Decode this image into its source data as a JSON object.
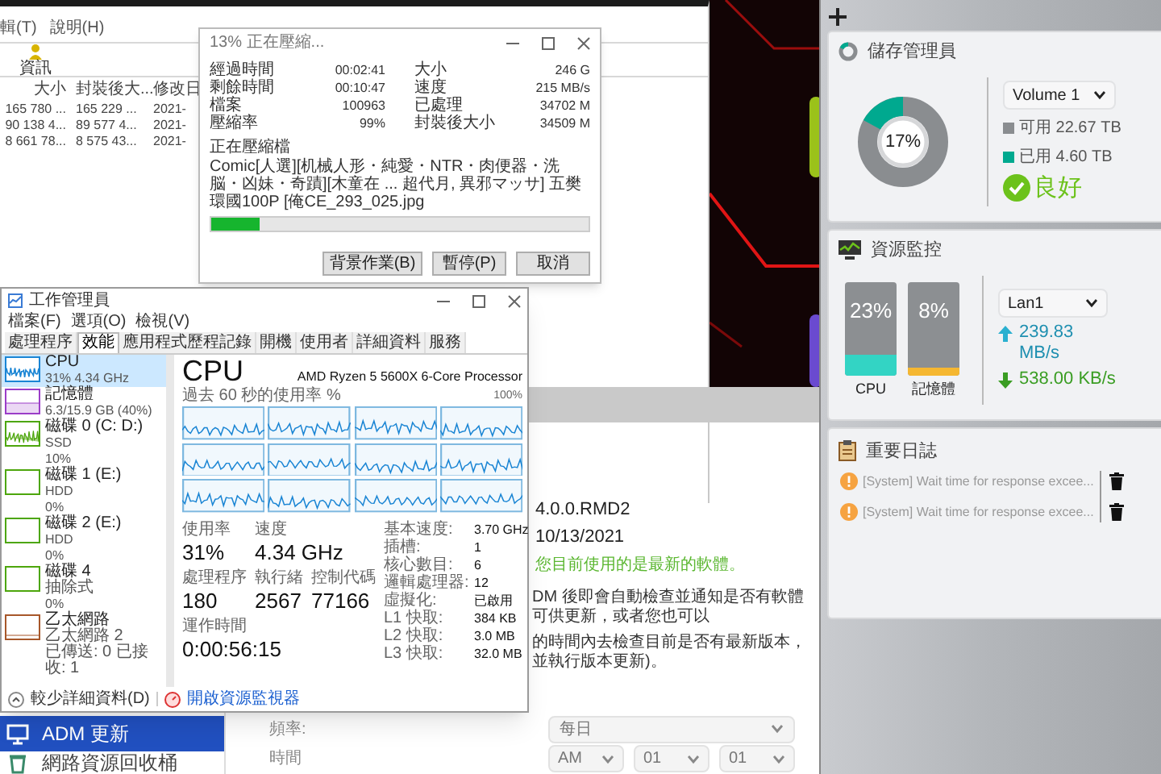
{
  "explorer": {
    "menu": [
      "輯(T)",
      "說明(H)"
    ],
    "toolbar_button": "資訊",
    "columns": [
      "大小",
      "封裝後大...",
      "修改日"
    ],
    "rows": [
      [
        "165 780 ...",
        "165 229 ...",
        "2021-"
      ],
      [
        "90 138 4...",
        "89 577 4...",
        "2021-"
      ],
      [
        "8 661 78...",
        "8 575 43...",
        "2021-"
      ]
    ]
  },
  "compress_dialog": {
    "title": "13% 正在壓縮...",
    "stats_left": [
      {
        "label": "經過時間",
        "value": "00:02:41"
      },
      {
        "label": "剩餘時間",
        "value": "00:10:47"
      },
      {
        "label": "檔案",
        "value": "100963"
      },
      {
        "label": "壓縮率",
        "value": "99%"
      }
    ],
    "stats_right": [
      {
        "label": "大小",
        "value": "246 G"
      },
      {
        "label": "速度",
        "value": "215 MB/s"
      },
      {
        "label": "已處理",
        "value": "34702 M"
      },
      {
        "label": "封裝後大小",
        "value": "34509 M"
      }
    ],
    "current_label": "正在壓縮檔",
    "current_file": "Comic[人選][机械人形・純愛・NTR・肉便器・洗脳・凶妹・奇蹟][木童在 ... 超代月, 異邪マッサ] 五樊環國100P [俺CE_293_025.jpg",
    "level": 0.13,
    "buttons": [
      "背景作業(B)",
      "暫停(P)",
      "取消"
    ]
  },
  "task_manager": {
    "title": "工作管理員",
    "menu": [
      "檔案(F)",
      "選項(O)",
      "檢視(V)"
    ],
    "tabs": [
      {
        "label": "處理程序",
        "selected": false
      },
      {
        "label": "效能",
        "selected": true
      },
      {
        "label": "應用程式歷程記錄",
        "selected": false
      },
      {
        "label": "開機",
        "selected": false
      },
      {
        "label": "使用者",
        "selected": false
      },
      {
        "label": "詳細資料",
        "selected": false
      },
      {
        "label": "服務",
        "selected": false
      }
    ],
    "devices": [
      {
        "kind": "cpu",
        "name": "CPU",
        "lines": [
          "31% 4.34 GHz"
        ],
        "selected": true,
        "active": true,
        "color": "#1a85d4"
      },
      {
        "kind": "memory",
        "name": "記憶體",
        "lines": [
          "6.3/15.9 GB (40%)"
        ],
        "selected": false,
        "active": true,
        "color": "#9b3dc8"
      },
      {
        "kind": "disk",
        "name": "磁碟 0 (C: D:)",
        "lines": [
          "SSD",
          "10%"
        ],
        "selected": false,
        "active": true,
        "color": "#4da60c"
      },
      {
        "kind": "disk",
        "name": "磁碟 1 (E:)",
        "lines": [
          "HDD",
          "0%"
        ],
        "selected": false,
        "active": false,
        "color": "#4da60c"
      },
      {
        "kind": "disk",
        "name": "磁碟 2 (E:)",
        "lines": [
          "HDD",
          "0%"
        ],
        "selected": false,
        "active": false,
        "color": "#4da60c"
      },
      {
        "kind": "disk",
        "name": "磁碟 4",
        "lines": [
          "抽除式",
          "0%"
        ],
        "selected": false,
        "active": false,
        "color": "#4da60c"
      },
      {
        "kind": "network",
        "name": "乙太網路",
        "lines": [
          "乙太網路 2",
          "已傳送: 0 已接收: 1"
        ],
        "selected": false,
        "active": true,
        "color": "#a7572a"
      }
    ],
    "heading": "CPU",
    "processor": "AMD Ryzen 5 5600X 6-Core Processor",
    "graph_caption": "過去 60 秒的使用率 %",
    "graph_max": "100%",
    "stats": [
      {
        "label": "使用率",
        "value": "31%"
      },
      {
        "label": "速度",
        "value": "4.34 GHz"
      },
      {
        "label": "處理程序",
        "value": "180"
      },
      {
        "label": "執行緒",
        "value": "2567"
      },
      {
        "label": "控制代碼",
        "value": "77166"
      },
      {
        "label": "運作時間",
        "value": "0:00:56:15"
      }
    ],
    "specs": [
      {
        "label": "基本速度:",
        "value": "3.70 GHz"
      },
      {
        "label": "插槽:",
        "value": "1"
      },
      {
        "label": "核心數目:",
        "value": "6"
      },
      {
        "label": "邏輯處理器:",
        "value": "12"
      },
      {
        "label": "虛擬化:",
        "value": "已啟用"
      },
      {
        "label": "L1 快取:",
        "value": "384 KB"
      },
      {
        "label": "L2 快取:",
        "value": "3.0 MB"
      },
      {
        "label": "L3 快取:",
        "value": "32.0 MB"
      }
    ],
    "footer": {
      "less_details": "較少詳細資料(D)",
      "resource_monitor": "開啟資源監視器"
    }
  },
  "adm": {
    "sidebar": [
      {
        "label": "ADM 更新",
        "selected": true
      },
      {
        "label": "網路資源回收桶",
        "selected": false
      }
    ],
    "version": "4.0.0.RMD2",
    "date": "10/13/2021",
    "status": "您目前使用的是最新的軟體。",
    "paragraph_1": "DM 後即會自動檢查並通知是否有軟體可供更新，或者您也可以",
    "paragraph_2": "的時間內去檢查目前是否有最新版本，並執行版本更新)。",
    "frequency": {
      "label": "頻率:",
      "value": "每日"
    },
    "time": {
      "label": "時間",
      "values": [
        "AM",
        "01",
        "01"
      ]
    }
  },
  "widgets": {
    "storage": {
      "title": "儲存管理員",
      "percent": "17%",
      "volume": "Volume 1",
      "legend": [
        {
          "label": "可用 22.67 TB",
          "color": "#8a8d90"
        },
        {
          "label": "已用 4.60 TB",
          "color": "#00a98f"
        }
      ],
      "health": "良好"
    },
    "resource": {
      "title": "資源監控",
      "meters": [
        {
          "label": "CPU",
          "percent": "23%",
          "level": 0.23,
          "color": "#33d4c4"
        },
        {
          "label": "記憶體",
          "percent": "8%",
          "level": 0.08,
          "color": "#f5b731"
        }
      ],
      "interface": "Lan1",
      "upload": "239.83 MB/s",
      "download": "538.00 KB/s"
    },
    "log": {
      "title": "重要日誌",
      "entries": [
        "[System] Wait time for response excee...",
        "[System] Wait time for response excee..."
      ]
    }
  }
}
